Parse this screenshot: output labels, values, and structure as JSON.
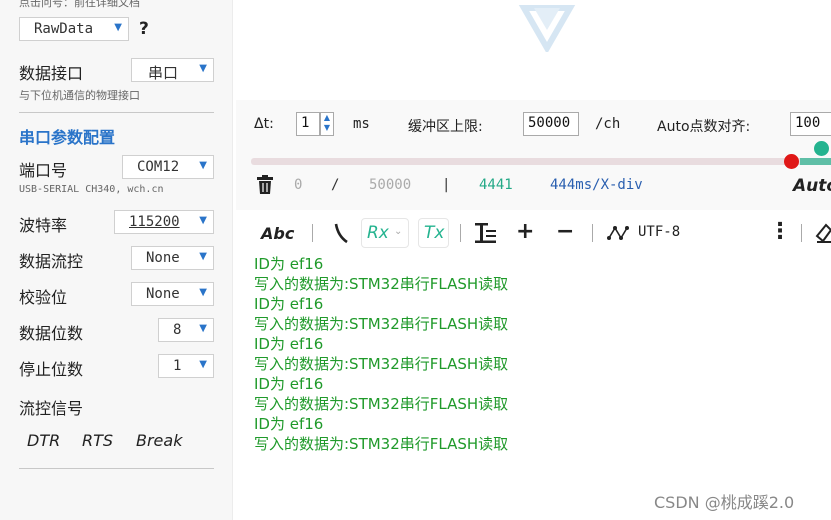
{
  "left": {
    "top_hint": "点击问号：前往详细文档",
    "mode_select": "RawData",
    "help": "?",
    "interface_label": "数据接口",
    "interface_value": "串口",
    "interface_hint": "与下位机通信的物理接口",
    "section_title": "串口参数配置",
    "port_label": "端口号",
    "port_value": "COM12",
    "port_hint": "USB-SERIAL CH340, wch.cn",
    "baud_label": "波特率",
    "baud_value": "115200",
    "flow_label": "数据流控",
    "flow_value": "None",
    "parity_label": "校验位",
    "parity_value": "None",
    "databits_label": "数据位数",
    "databits_value": "8",
    "stopbits_label": "停止位数",
    "stopbits_value": "1",
    "flowsig_label": "流控信号",
    "signals": [
      "DTR",
      "RTS",
      "Break"
    ]
  },
  "controls": {
    "dt_label": "Δt:",
    "dt_value": "1",
    "dt_unit": "ms",
    "buffer_label": "缓冲区上限:",
    "buffer_value": "50000",
    "buffer_unit": "/ch",
    "auto_label": "Auto点数对齐:",
    "auto_value": "100",
    "stats": {
      "count": "0",
      "slash": "/",
      "limit": "50000",
      "bar": "|",
      "points": "4441",
      "scale": "444ms/X-div",
      "auto": "Auto"
    }
  },
  "toolbar": {
    "abc": "Abc",
    "rx": "Rx",
    "tx": "Tx",
    "plus": "+",
    "minus": "−",
    "encoding": "UTF-8",
    "more": "⋮"
  },
  "terminal": {
    "lines": [
      "ID为 ef16",
      "写入的数据为:STM32串行FLASH读取",
      "ID为 ef16",
      "写入的数据为:STM32串行FLASH读取",
      "ID为 ef16",
      "写入的数据为:STM32串行FLASH读取",
      "ID为 ef16",
      "写入的数据为:STM32串行FLASH读取",
      "ID为 ef16",
      "写入的数据为:STM32串行FLASH读取"
    ]
  },
  "watermark": "CSDN @桃成蹊2.0",
  "colors": {
    "accent": "#2a74c9",
    "terminal_text": "#1f9a2a",
    "slider_red": "#e01717",
    "slider_green": "#24b38f"
  }
}
